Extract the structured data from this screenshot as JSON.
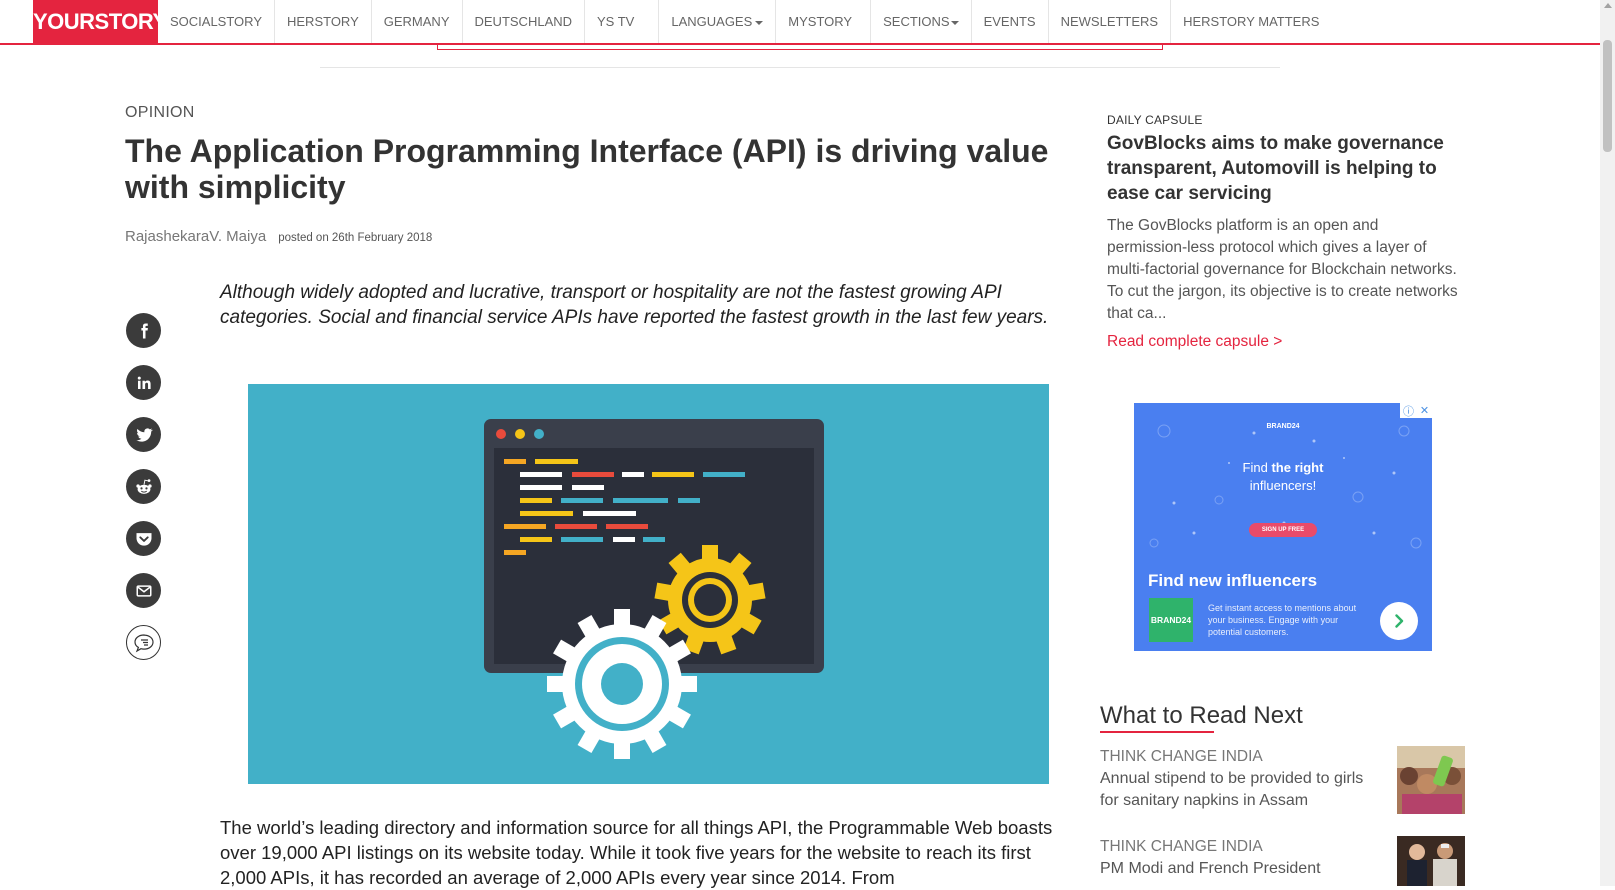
{
  "site": {
    "logo": "YOURSTORY",
    "nav": [
      {
        "label": "SOCIALSTORY",
        "dropdown": false
      },
      {
        "label": "HERSTORY",
        "dropdown": false
      },
      {
        "label": "GERMANY",
        "dropdown": false
      },
      {
        "label": "DEUTSCHLAND",
        "dropdown": false
      },
      {
        "label": "YS TV",
        "dropdown": false
      },
      {
        "label": "LANGUAGES",
        "dropdown": true
      },
      {
        "label": "MYSTORY",
        "dropdown": false
      },
      {
        "label": "SECTIONS",
        "dropdown": true
      },
      {
        "label": "EVENTS",
        "dropdown": false
      },
      {
        "label": "NEWSLETTERS",
        "dropdown": false
      },
      {
        "label": "HERSTORY MATTERS",
        "dropdown": false
      }
    ],
    "accent_color": "#e4243f"
  },
  "article": {
    "category": "OPINION",
    "title": "The Application Programming Interface (API) is driving value with simplicity",
    "author": "RajashekaraV. Maiya",
    "date": "posted on 26th February 2018",
    "lede": "Although widely adopted and lucrative, transport or hospitality are not the fastest growing API categories. Social and financial service APIs have reported the fastest growth in the last few years.",
    "body": "The world’s leading directory and information source for all things API, the Programmable Web boasts over 19,000 API listings on its website today. While it took five years for the website to reach its first 2,000 APIs, it has recorded an average of 2,000 APIs every year since 2014. From",
    "hero_colors": {
      "background": "#42b0c8",
      "window": "#3a3f4b",
      "gear_large": "#ffffff",
      "gear_small": "#f5c518"
    }
  },
  "share_icons": [
    "facebook-icon",
    "linkedin-icon",
    "twitter-icon",
    "reddit-icon",
    "pocket-icon",
    "email-icon",
    "comment-icon"
  ],
  "capsule": {
    "label": "DAILY CAPSULE",
    "title": "GovBlocks aims to make governance transparent, Automovill is helping to ease car servicing",
    "text": "The GovBlocks platform is an open and permission-less protocol which gives a layer of multi-factorial governance for Blockchain networks. To cut the jargon, its objective is to create networks that ca...",
    "link": "Read complete capsule >"
  },
  "ad": {
    "brand_small": "BRAND24",
    "find_pre": "Find ",
    "find_bold": "the right",
    "find_post": "influencers!",
    "signup": "SIGN UP FREE",
    "headline": "Find new influencers",
    "logo": "BRAND24",
    "desc": "Get instant access to mentions about your business. Engage with your potential customers.",
    "background": "#4a7ff0"
  },
  "read_next": {
    "heading": "What to Read Next",
    "items": [
      {
        "category": "THINK CHANGE INDIA",
        "title": "Annual stipend to be provided to girls for sanitary napkins in Assam"
      },
      {
        "category": "THINK CHANGE INDIA",
        "title": "PM Modi and French President"
      }
    ]
  }
}
